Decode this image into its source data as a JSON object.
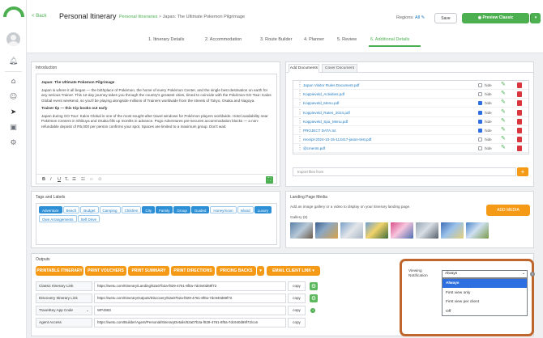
{
  "header": {
    "back_label": "Back",
    "page_title": "Personal Itinerary",
    "breadcrumb_link": "Personal Itineraries",
    "breadcrumb_sep": ">",
    "breadcrumb_current": "Japan: The Ultimate Pokemon Pilgrimage",
    "regions_label": "Regions:",
    "regions_value": "All",
    "save_label": "Save",
    "preview_label": "Preview Classic"
  },
  "steps": [
    "1. Itinerary Details",
    "2. Accommodation",
    "3. Route Builder",
    "4. Planner",
    "5. Review",
    "6. Additional Details"
  ],
  "intro": {
    "title": "Introduction",
    "heading": "Japan: The Ultimate Pokemon Pilgrimage",
    "para1": "Japan is where it all began — the birthplace of Pokémon, the home of every Pokémon Center, and the single best destination on earth for any serious Trainer. This 12-day journey takes you through the country's greatest cities, timed to coincide with the Pokémon GO Tour: Kalos Global event weekend, so you'll be playing alongside millions of Trainers worldwide from the streets of Tokyo, Osaka and Nagoya.",
    "subheading": "Trainer tip — this trip books out early",
    "para2": "Japan during GO Tour: Kalos Global is one of the most sought-after travel windows for Pokémon players worldwide. Hotel availability near Pokémon Centers in Shibuya and Osaka fills up months in advance. Pogo Adventures pre-secures accommodation blocks — a non-refundable deposit of R5,000 per person confirms your spot. Spaces are limited to a maximum group. Don't wait."
  },
  "documents": {
    "tab_add": "Add Documents",
    "tab_cover": "Cover Document",
    "hide_label": "hide",
    "files": [
      {
        "name": "Japan Visitor Rules Document.pdf",
        "hidden": false
      },
      {
        "name": "Koppieveld_Activities.pdf",
        "hidden": false
      },
      {
        "name": "Koppieveld_Menu.pdf",
        "hidden": true
      },
      {
        "name": "Koppieveld_Rates_2024.pdf",
        "hidden": true
      },
      {
        "name": "Koppieveld_Spa_Menu.pdf",
        "hidden": true
      },
      {
        "name": "PROJECT DATA.txt",
        "hidden": true
      },
      {
        "name": "receipt-2024-10-15-113417-jason-test.pdf",
        "hidden": false
      },
      {
        "name": "@cments.pdf",
        "hidden": false
      }
    ],
    "import_label": "Import files from",
    "add_symbol": "+"
  },
  "tags": {
    "title": "Tags and Labels",
    "items": [
      {
        "label": "Adventure",
        "selected": true
      },
      {
        "label": "Beach",
        "selected": false
      },
      {
        "label": "Budget",
        "selected": false
      },
      {
        "label": "Camping",
        "selected": false
      },
      {
        "label": "Children",
        "selected": false
      },
      {
        "label": "City",
        "selected": true
      },
      {
        "label": "Family",
        "selected": true
      },
      {
        "label": "Group",
        "selected": true
      },
      {
        "label": "Guided",
        "selected": true
      },
      {
        "label": "Honeymoon",
        "selected": false
      },
      {
        "label": "Island",
        "selected": false
      },
      {
        "label": "Luxury",
        "selected": true
      },
      {
        "label": "Own Arrangements",
        "selected": false
      },
      {
        "label": "Self Drive",
        "selected": false
      }
    ]
  },
  "media": {
    "title": "Landing Page Media",
    "desc": "Add an image gallery or a video to display on your itinerary landing page.",
    "button": "ADD MEDIA",
    "gallery_label": "Gallery (8)"
  },
  "outputs": {
    "title": "Outputs",
    "buttons": [
      "PRINTABLE ITINERARY",
      "PRINT VOUCHERS",
      "PRINT SUMMARY",
      "PRINT DIRECTIONS",
      "PRICING BACKS",
      "EMAIL CLIENT LINK"
    ],
    "caret": "▾",
    "copy_label": "copy",
    "rows": [
      {
        "label": "Classic Itinerary Link",
        "value": "https://wetu.com/Itinerary/Landing/52a07b2a-f829-4761-8f0a-7dc940d69f72"
      },
      {
        "label": "Discovery Itinerary Link",
        "value": "https://wetu.com/ItineraryOutputs/Discovery/52a07b2a-f829-4761-8f0a-7dc940d69f72"
      },
      {
        "label": "TravelKey App Code",
        "value": "WP4583"
      },
      {
        "label": "Agent Access",
        "value": "https://wetu.com/Builder/Agent/Personal/ItineraryDetails/52a07b2a-f829-4761-8f0a-7dc940d69f72/con"
      }
    ]
  },
  "viewing": {
    "label_line1": "Viewing",
    "label_line2": "Notification",
    "selected": "Always",
    "options": [
      "Always",
      "First view only",
      "First view per client",
      "Off"
    ],
    "info_icon": "i"
  },
  "colors": {
    "accent": "#4caf50",
    "orange": "#f59a16",
    "highlight": "#c0652c",
    "link": "#1f7ac0"
  }
}
